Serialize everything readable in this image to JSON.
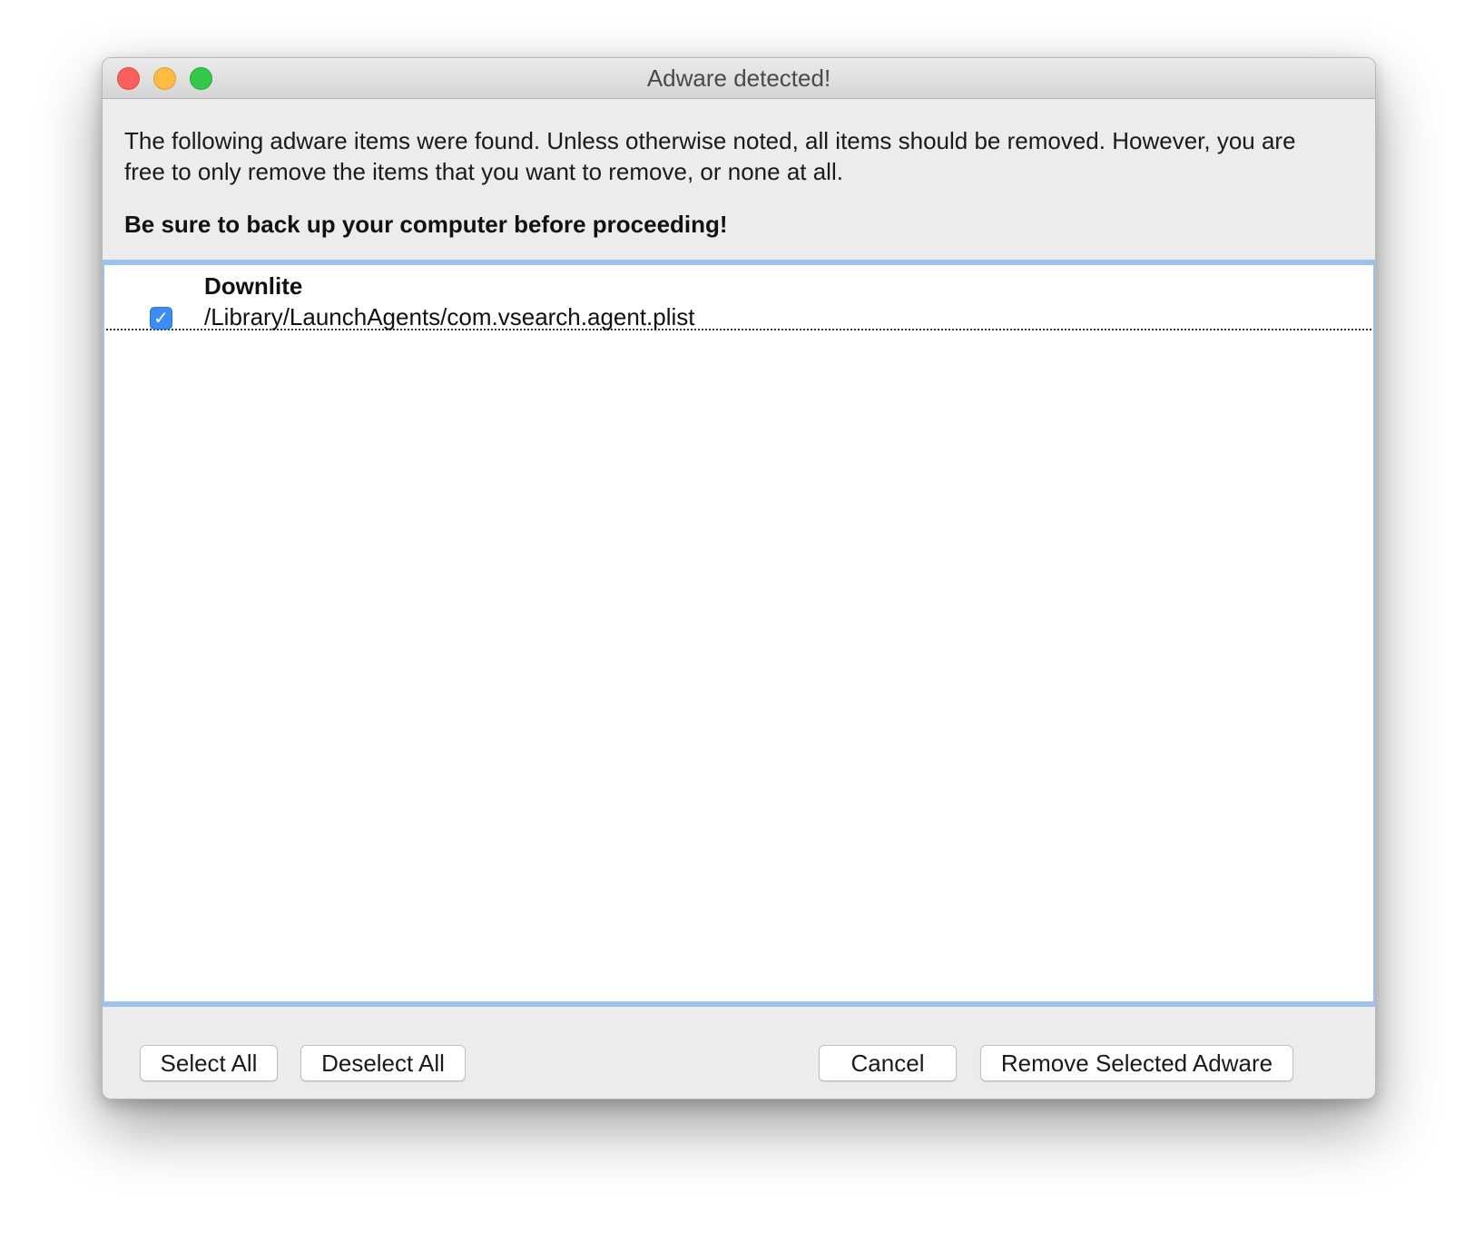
{
  "window": {
    "title": "Adware detected!"
  },
  "dialog": {
    "message": "The following adware items were found. Unless otherwise noted, all items should be removed. However, you are free to only remove the items that you want to remove, or none at all.",
    "warning": "Be sure to back up your computer before proceeding!"
  },
  "adware_items": [
    {
      "name": "Downlite",
      "path": "/Library/LaunchAgents/com.vsearch.agent.plist",
      "checked": true,
      "checkmark": "✓"
    }
  ],
  "buttons": {
    "select_all": "Select All",
    "deselect_all": "Deselect All",
    "cancel": "Cancel",
    "remove": "Remove Selected Adware"
  },
  "colors": {
    "accent": "#3b8cf5",
    "list_border": "#9dc2eb",
    "close": "#fc605c",
    "minimize": "#fdbc40",
    "zoom": "#34c84a"
  },
  "icons": {
    "close": "close-icon",
    "minimize": "minimize-icon",
    "zoom": "zoom-icon",
    "checkbox": "checkmark-icon"
  }
}
